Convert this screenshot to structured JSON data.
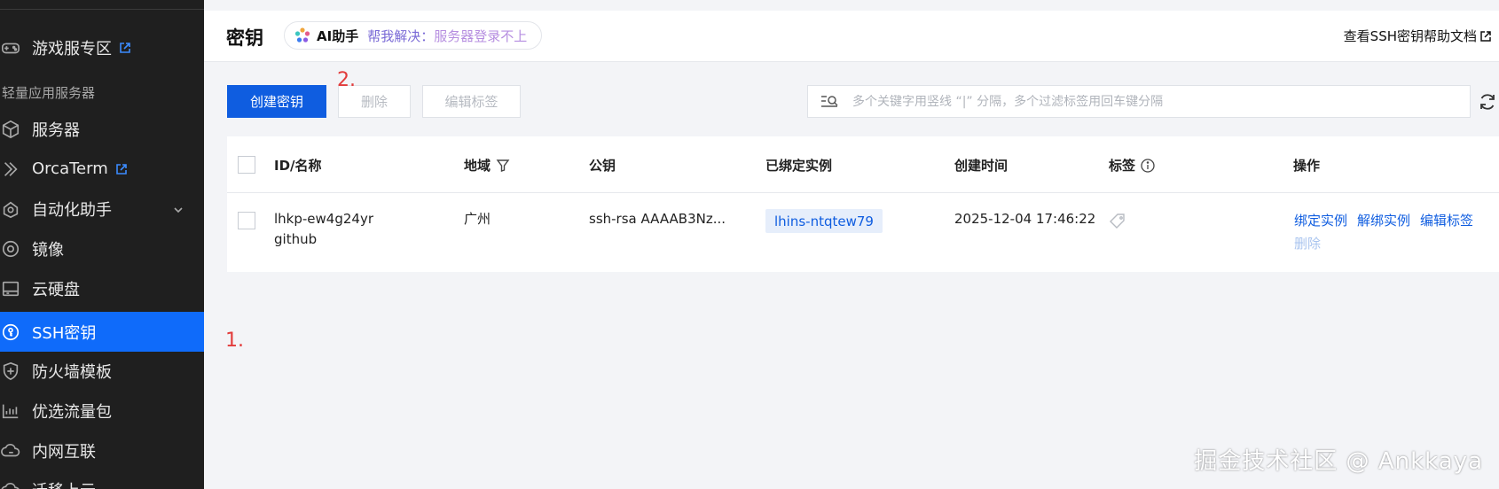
{
  "sidebar": {
    "items": [
      {
        "label": "游戏服专区",
        "icon": "gamepad-icon",
        "external": true
      },
      {
        "label": "服务器",
        "icon": "cube-icon"
      },
      {
        "label": "OrcaTerm",
        "icon": "terminal-icon",
        "external": true
      },
      {
        "label": "自动化助手",
        "icon": "robot-icon",
        "expandable": true
      },
      {
        "label": "镜像",
        "icon": "disc-icon"
      },
      {
        "label": "云硬盘",
        "icon": "hdd-icon"
      },
      {
        "label": "SSH密钥",
        "icon": "key-icon",
        "active": true
      },
      {
        "label": "防火墙模板",
        "icon": "shield-icon"
      },
      {
        "label": "优选流量包",
        "icon": "traffic-icon"
      },
      {
        "label": "内网互联",
        "icon": "network-icon"
      },
      {
        "label": "迁移上云",
        "icon": "cloud-icon"
      }
    ],
    "section_label": "轻量应用服务器"
  },
  "header": {
    "title": "密钥",
    "ai_label": "AI助手",
    "ai_hint_prefix": "帮我解决：",
    "ai_hint": "服务器登录不上",
    "help_link": "查看SSH密钥帮助文档"
  },
  "toolbar": {
    "create_label": "创建密钥",
    "delete_label": "删除",
    "edit_tags_label": "编辑标签",
    "search_placeholder": "多个关键字用竖线 “|” 分隔，多个过滤标签用回车键分隔"
  },
  "annotations": {
    "one": "1.",
    "two": "2."
  },
  "table": {
    "headers": {
      "id": "ID/名称",
      "region": "地域",
      "public_key": "公钥",
      "instances": "已绑定实例",
      "created": "创建时间",
      "tags": "标签",
      "actions": "操作"
    },
    "rows": [
      {
        "id": "lhkp-ew4g24yr",
        "name": "github",
        "region": "广州",
        "public_key": "ssh-rsa AAAAB3Nz...",
        "instance": "lhins-ntqtew79",
        "created": "2025-12-04 17:46:22",
        "actions": {
          "bind": "绑定实例",
          "unbind": "解绑实例",
          "edit_tags": "编辑标签",
          "delete": "删除"
        }
      }
    ]
  },
  "watermark": "掘金技术社区 @ Ankkaya",
  "colors": {
    "accent": "#0f5de0",
    "sidebar_active": "#0f6bfa",
    "sidebar_bg": "#1f1f1f",
    "annotation": "#e23b3b"
  }
}
